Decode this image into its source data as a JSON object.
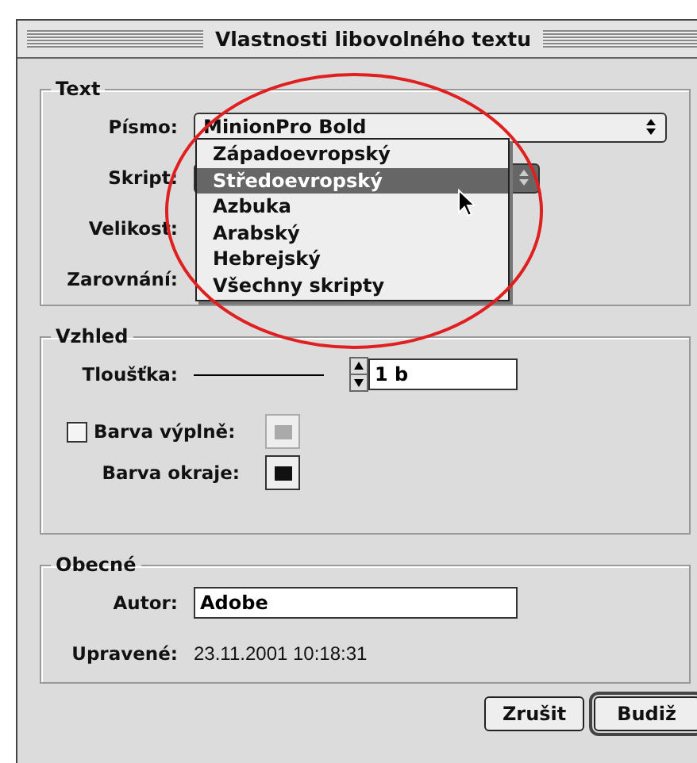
{
  "window": {
    "title": "Vlastnosti libovolného textu"
  },
  "text_group": {
    "title": "Text",
    "font": {
      "label": "Písmo:",
      "value": "MinionPro Bold"
    },
    "script": {
      "label": "Skript:"
    },
    "size": {
      "label": "Velikost:"
    },
    "alignment": {
      "label": "Zarovnání:"
    },
    "script_menu": {
      "items": [
        {
          "label": "Západoevropský",
          "selected": false
        },
        {
          "label": "Středoevropský",
          "selected": true
        },
        {
          "label": "Azbuka",
          "selected": false
        },
        {
          "label": "Arabský",
          "selected": false
        },
        {
          "label": "Hebrejský",
          "selected": false
        },
        {
          "label": "Všechny skripty",
          "selected": false
        }
      ]
    }
  },
  "appearance": {
    "title": "Vzhled",
    "stroke_weight": {
      "label": "Tloušťka:",
      "value": "1 b"
    },
    "fill_color": {
      "label": "Barva výplně:",
      "checked": false
    },
    "stroke_color": {
      "label": "Barva okraje:"
    }
  },
  "general": {
    "title": "Obecné",
    "author": {
      "label": "Autor:",
      "value": "Adobe"
    },
    "modified": {
      "label": "Upravené:",
      "value": "23.11.2001 10:18:31"
    }
  },
  "buttons": [
    {
      "label": "Zrušit",
      "default": false
    },
    {
      "label": "Budiž",
      "default": true
    }
  ]
}
